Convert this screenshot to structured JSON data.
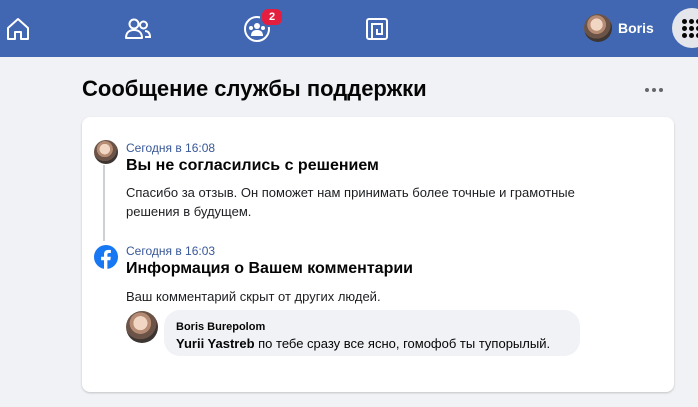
{
  "nav": {
    "items": [
      {
        "name": "home",
        "icon": "home-icon"
      },
      {
        "name": "friends",
        "icon": "friends-icon"
      },
      {
        "name": "groups",
        "icon": "groups-icon",
        "badge": "2"
      },
      {
        "name": "gaming",
        "icon": "gaming-icon"
      }
    ],
    "profile_name": "Boris",
    "apps_icon": "apps-grid-icon",
    "colors": {
      "bar": "#4267b2",
      "badge": "#e41e3f"
    }
  },
  "page": {
    "title": "Сообщение службы поддержки",
    "more_icon": "more-horizontal-icon"
  },
  "messages": [
    {
      "timestamp": "Сегодня в 16:08",
      "title": "Вы не согласились с решением",
      "body": "Спасибо за отзыв. Он поможет нам принимать более точные и грамотные решения в будущем."
    },
    {
      "timestamp": "Сегодня в 16:03",
      "title": "Информация о Вашем комментарии",
      "body": "Ваш комментарий скрыт от других людей."
    }
  ],
  "comment": {
    "author": "Boris Burepolom",
    "mention": "Yurii Yastreb",
    "text": " по тебе сразу все ясно, гомофоб ты тупорылый."
  }
}
